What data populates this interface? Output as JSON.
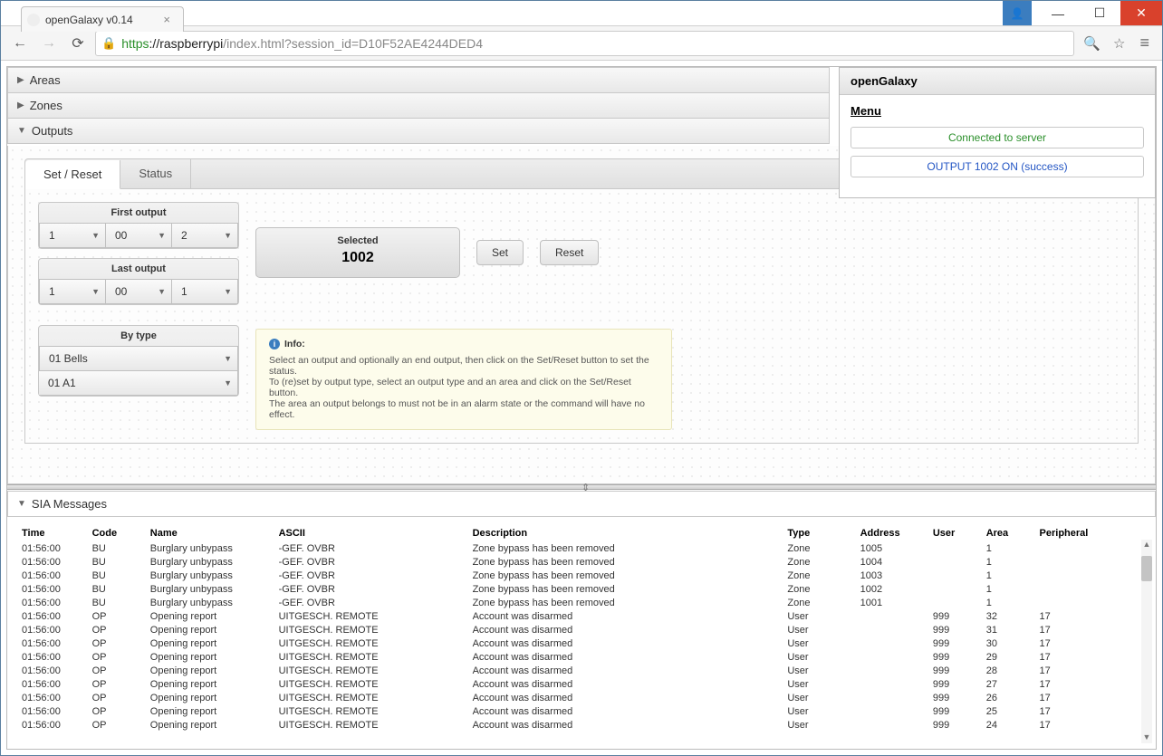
{
  "window": {
    "title": "openGalaxy v0.14"
  },
  "browser": {
    "url_proto": "https",
    "url_host": "://raspberrypi",
    "url_rest": "/index.html?session_id=D10F52AE4244DED4"
  },
  "accordion": {
    "areas": "Areas",
    "zones": "Zones",
    "outputs": "Outputs",
    "sia": "SIA Messages"
  },
  "outputs": {
    "tabs": {
      "setreset": "Set / Reset",
      "status": "Status"
    },
    "first_label": "First output",
    "first": {
      "a": "1",
      "b": "00",
      "c": "2"
    },
    "last_label": "Last output",
    "last": {
      "a": "1",
      "b": "00",
      "c": "1"
    },
    "bytype_label": "By type",
    "bytype": {
      "type": "01  Bells",
      "area": "01  A1"
    },
    "selected_label": "Selected",
    "selected_value": "1002",
    "set_btn": "Set",
    "reset_btn": "Reset",
    "info_head": "Info:",
    "info_l1": "Select an output and optionally an end output, then click on the Set/Reset button to set the status.",
    "info_l2": "To (re)set by output type, select an output type and an area and click on the Set/Reset button.",
    "info_l3": "The area an output belongs to must not be in an alarm state or the command will have no effect."
  },
  "status": {
    "title": "openGalaxy",
    "menu": "Menu",
    "connected": "Connected to server",
    "lastmsg": "OUTPUT 1002 ON (success)"
  },
  "sia": {
    "headers": {
      "time": "Time",
      "code": "Code",
      "name": "Name",
      "ascii": "ASCII",
      "desc": "Description",
      "type": "Type",
      "addr": "Address",
      "user": "User",
      "area": "Area",
      "periph": "Peripheral"
    },
    "rows": [
      {
        "time": "01:56:00",
        "code": "BU",
        "name": "Burglary unbypass",
        "ascii": "-GEF. OVBR",
        "desc": "Zone bypass has been removed",
        "type": "Zone",
        "addr": "1005",
        "user": "",
        "area": "1",
        "periph": ""
      },
      {
        "time": "01:56:00",
        "code": "BU",
        "name": "Burglary unbypass",
        "ascii": "-GEF. OVBR",
        "desc": "Zone bypass has been removed",
        "type": "Zone",
        "addr": "1004",
        "user": "",
        "area": "1",
        "periph": ""
      },
      {
        "time": "01:56:00",
        "code": "BU",
        "name": "Burglary unbypass",
        "ascii": "-GEF. OVBR",
        "desc": "Zone bypass has been removed",
        "type": "Zone",
        "addr": "1003",
        "user": "",
        "area": "1",
        "periph": ""
      },
      {
        "time": "01:56:00",
        "code": "BU",
        "name": "Burglary unbypass",
        "ascii": "-GEF. OVBR",
        "desc": "Zone bypass has been removed",
        "type": "Zone",
        "addr": "1002",
        "user": "",
        "area": "1",
        "periph": ""
      },
      {
        "time": "01:56:00",
        "code": "BU",
        "name": "Burglary unbypass",
        "ascii": "-GEF. OVBR",
        "desc": "Zone bypass has been removed",
        "type": "Zone",
        "addr": "1001",
        "user": "",
        "area": "1",
        "periph": ""
      },
      {
        "time": "01:56:00",
        "code": "OP",
        "name": "Opening report",
        "ascii": "UITGESCH. REMOTE",
        "desc": "Account was disarmed",
        "type": "User",
        "addr": "",
        "user": "999",
        "area": "32",
        "periph": "17"
      },
      {
        "time": "01:56:00",
        "code": "OP",
        "name": "Opening report",
        "ascii": "UITGESCH. REMOTE",
        "desc": "Account was disarmed",
        "type": "User",
        "addr": "",
        "user": "999",
        "area": "31",
        "periph": "17"
      },
      {
        "time": "01:56:00",
        "code": "OP",
        "name": "Opening report",
        "ascii": "UITGESCH. REMOTE",
        "desc": "Account was disarmed",
        "type": "User",
        "addr": "",
        "user": "999",
        "area": "30",
        "periph": "17"
      },
      {
        "time": "01:56:00",
        "code": "OP",
        "name": "Opening report",
        "ascii": "UITGESCH. REMOTE",
        "desc": "Account was disarmed",
        "type": "User",
        "addr": "",
        "user": "999",
        "area": "29",
        "periph": "17"
      },
      {
        "time": "01:56:00",
        "code": "OP",
        "name": "Opening report",
        "ascii": "UITGESCH. REMOTE",
        "desc": "Account was disarmed",
        "type": "User",
        "addr": "",
        "user": "999",
        "area": "28",
        "periph": "17"
      },
      {
        "time": "01:56:00",
        "code": "OP",
        "name": "Opening report",
        "ascii": "UITGESCH. REMOTE",
        "desc": "Account was disarmed",
        "type": "User",
        "addr": "",
        "user": "999",
        "area": "27",
        "periph": "17"
      },
      {
        "time": "01:56:00",
        "code": "OP",
        "name": "Opening report",
        "ascii": "UITGESCH. REMOTE",
        "desc": "Account was disarmed",
        "type": "User",
        "addr": "",
        "user": "999",
        "area": "26",
        "periph": "17"
      },
      {
        "time": "01:56:00",
        "code": "OP",
        "name": "Opening report",
        "ascii": "UITGESCH. REMOTE",
        "desc": "Account was disarmed",
        "type": "User",
        "addr": "",
        "user": "999",
        "area": "25",
        "periph": "17"
      },
      {
        "time": "01:56:00",
        "code": "OP",
        "name": "Opening report",
        "ascii": "UITGESCH. REMOTE",
        "desc": "Account was disarmed",
        "type": "User",
        "addr": "",
        "user": "999",
        "area": "24",
        "periph": "17"
      }
    ]
  }
}
